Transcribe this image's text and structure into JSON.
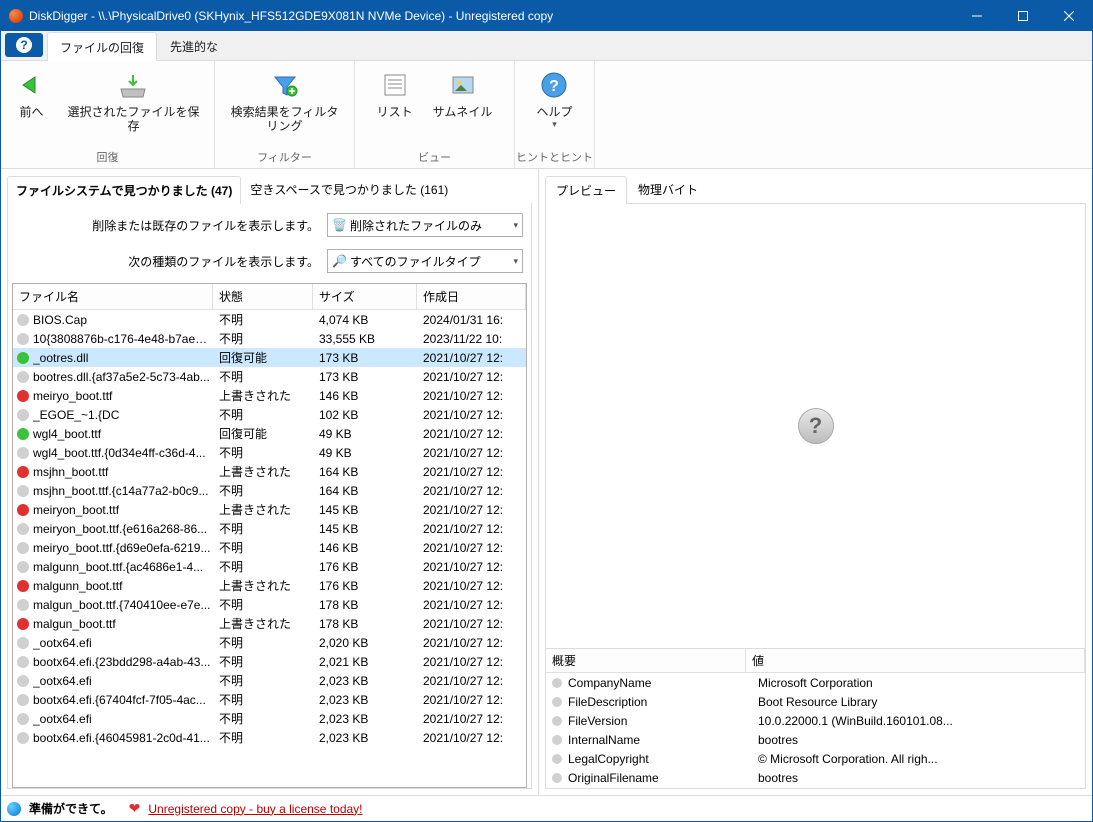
{
  "window": {
    "title": "DiskDigger - \\\\.\\PhysicalDrive0 (SKHynix_HFS512GDE9X081N NVMe Device) - Unregistered copy"
  },
  "topTabs": {
    "recovery": "ファイルの回復",
    "advanced": "先進的な"
  },
  "ribbon": {
    "back": "前へ",
    "saveSelected": "選択されたファイルを保\n存",
    "filterResults": "検索結果をフィルタリング",
    "list": "リスト",
    "thumbnail": "サムネイル",
    "help": "ヘルプ",
    "grpRecovery": "回復",
    "grpFilter": "フィルター",
    "grpView": "ビュー",
    "grpHint": "ヒントとヒント"
  },
  "innerTabs": {
    "found": "ファイルシステムで見つかりました (47)",
    "free": "空きスペースで見つかりました (161)"
  },
  "filters": {
    "showDeletedLabel": "削除または既存のファイルを表示します。",
    "deletedOnly": "削除されたファイルのみ",
    "showTypeLabel": "次の種類のファイルを表示します。",
    "allTypes": "すべてのファイルタイプ"
  },
  "columns": {
    "name": "ファイル名",
    "status": "状態",
    "size": "サイズ",
    "created": "作成日"
  },
  "rows": [
    {
      "dot": "gray",
      "name": "BIOS.Cap",
      "status": "不明",
      "size": "4,074 KB",
      "date": "2024/01/31 16:"
    },
    {
      "dot": "gray",
      "name": "10{3808876b-c176-4e48-b7ae-0...",
      "status": "不明",
      "size": "33,555 KB",
      "date": "2023/11/22 10:"
    },
    {
      "dot": "green",
      "name": "_ootres.dll",
      "status": "回復可能",
      "size": "173 KB",
      "date": "2021/10/27 12:",
      "selected": true
    },
    {
      "dot": "gray",
      "name": "bootres.dll.{af37a5e2-5c73-4ab...",
      "status": "不明",
      "size": "173 KB",
      "date": "2021/10/27 12:"
    },
    {
      "dot": "red",
      "name": "meiryo_boot.ttf",
      "status": "上書きされた",
      "size": "146 KB",
      "date": "2021/10/27 12:"
    },
    {
      "dot": "gray",
      "name": "_EGOE_~1.{DC",
      "status": "不明",
      "size": "102 KB",
      "date": "2021/10/27 12:"
    },
    {
      "dot": "green",
      "name": "wgl4_boot.ttf",
      "status": "回復可能",
      "size": "49 KB",
      "date": "2021/10/27 12:"
    },
    {
      "dot": "gray",
      "name": "wgl4_boot.ttf.{0d34e4ff-c36d-4...",
      "status": "不明",
      "size": "49 KB",
      "date": "2021/10/27 12:"
    },
    {
      "dot": "red",
      "name": "msjhn_boot.ttf",
      "status": "上書きされた",
      "size": "164 KB",
      "date": "2021/10/27 12:"
    },
    {
      "dot": "gray",
      "name": "msjhn_boot.ttf.{c14a77a2-b0c9...",
      "status": "不明",
      "size": "164 KB",
      "date": "2021/10/27 12:"
    },
    {
      "dot": "red",
      "name": "meiryon_boot.ttf",
      "status": "上書きされた",
      "size": "145 KB",
      "date": "2021/10/27 12:"
    },
    {
      "dot": "gray",
      "name": "meiryon_boot.ttf.{e616a268-86...",
      "status": "不明",
      "size": "145 KB",
      "date": "2021/10/27 12:"
    },
    {
      "dot": "gray",
      "name": "meiryo_boot.ttf.{d69e0efa-6219...",
      "status": "不明",
      "size": "146 KB",
      "date": "2021/10/27 12:"
    },
    {
      "dot": "gray",
      "name": "malgunn_boot.ttf.{ac4686e1-4...",
      "status": "不明",
      "size": "176 KB",
      "date": "2021/10/27 12:"
    },
    {
      "dot": "red",
      "name": "malgunn_boot.ttf",
      "status": "上書きされた",
      "size": "176 KB",
      "date": "2021/10/27 12:"
    },
    {
      "dot": "gray",
      "name": "malgun_boot.ttf.{740410ee-e7e...",
      "status": "不明",
      "size": "178 KB",
      "date": "2021/10/27 12:"
    },
    {
      "dot": "red",
      "name": "malgun_boot.ttf",
      "status": "上書きされた",
      "size": "178 KB",
      "date": "2021/10/27 12:"
    },
    {
      "dot": "gray",
      "name": "_ootx64.efi",
      "status": "不明",
      "size": "2,020 KB",
      "date": "2021/10/27 12:"
    },
    {
      "dot": "gray",
      "name": "bootx64.efi.{23bdd298-a4ab-43...",
      "status": "不明",
      "size": "2,021 KB",
      "date": "2021/10/27 12:"
    },
    {
      "dot": "gray",
      "name": "_ootx64.efi",
      "status": "不明",
      "size": "2,023 KB",
      "date": "2021/10/27 12:"
    },
    {
      "dot": "gray",
      "name": "bootx64.efi.{67404fcf-7f05-4ac...",
      "status": "不明",
      "size": "2,023 KB",
      "date": "2021/10/27 12:"
    },
    {
      "dot": "gray",
      "name": "_ootx64.efi",
      "status": "不明",
      "size": "2,023 KB",
      "date": "2021/10/27 12:"
    },
    {
      "dot": "gray",
      "name": "bootx64.efi.{46045981-2c0d-41...",
      "status": "不明",
      "size": "2,023 KB",
      "date": "2021/10/27 12:"
    }
  ],
  "previewTabs": {
    "preview": "プレビュー",
    "physical": "物理バイト"
  },
  "propCols": {
    "summary": "概要",
    "value": "値"
  },
  "props": [
    {
      "k": "CompanyName",
      "v": "Microsoft Corporation"
    },
    {
      "k": "FileDescription",
      "v": "Boot Resource Library"
    },
    {
      "k": "FileVersion",
      "v": "10.0.22000.1 (WinBuild.160101.08..."
    },
    {
      "k": "InternalName",
      "v": "bootres"
    },
    {
      "k": "LegalCopyright",
      "v": "© Microsoft Corporation. All righ..."
    },
    {
      "k": "OriginalFilename",
      "v": "bootres"
    }
  ],
  "status": {
    "ready": "準備ができて。",
    "unreg": "Unregistered copy - buy a license today!"
  }
}
